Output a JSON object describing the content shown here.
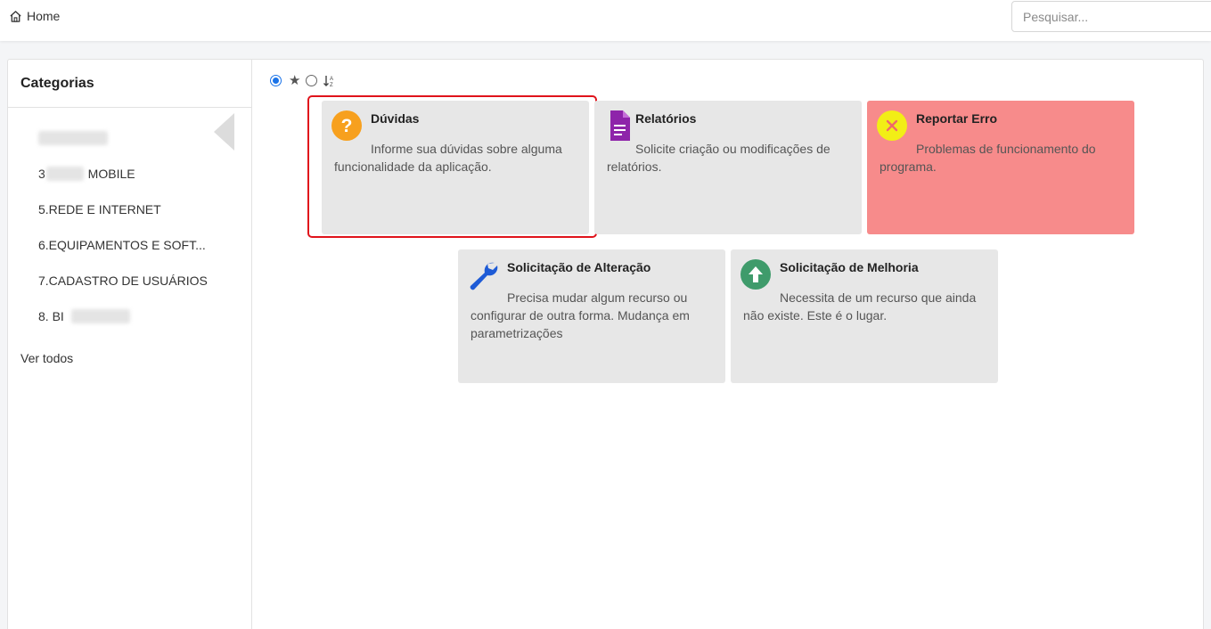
{
  "header": {
    "breadcrumb": "Home",
    "search_placeholder": "Pesquisar..."
  },
  "sidebar": {
    "title": "Categorias",
    "items": [
      {
        "prefix": "",
        "label": ""
      },
      {
        "prefix": "3",
        "label": " MOBILE"
      },
      {
        "prefix": "",
        "label": "5.REDE E INTERNET"
      },
      {
        "prefix": "",
        "label": "6.EQUIPAMENTOS E SOFT..."
      },
      {
        "prefix": "",
        "label": "7.CADASTRO DE USUÁRIOS"
      },
      {
        "prefix": "8. BI",
        "label": ""
      }
    ],
    "see_all": "Ver todos"
  },
  "cards": [
    {
      "title": "Dúvidas",
      "description": "Informe sua dúvidas sobre alguma funcionalidade da aplicação.",
      "icon": "question-icon",
      "color": "#e7e7e7",
      "icon_color": "#f7a01e"
    },
    {
      "title": "Relatórios",
      "description": "Solicite criação ou modificações de relatórios.",
      "icon": "document-icon",
      "color": "#e7e7e7",
      "icon_color": "#8e24aa"
    },
    {
      "title": "Reportar Erro",
      "description": "Problemas de funcionamento do programa.",
      "icon": "error-icon",
      "color": "#f78b8b",
      "icon_color": "#f2ee16"
    },
    {
      "title": "Solicitação de Alteração",
      "description": "Precisa mudar algum recurso ou configurar de outra forma. Mudança em parametrizações",
      "icon": "wrench-icon",
      "color": "#e7e7e7",
      "icon_color": "#1e5bd6"
    },
    {
      "title": "Solicitação de Melhoria",
      "description": "Necessita de um recurso que ainda não existe. Este é o lugar.",
      "icon": "arrow-up-icon",
      "color": "#e7e7e7",
      "icon_color": "#3f9b6b"
    }
  ]
}
